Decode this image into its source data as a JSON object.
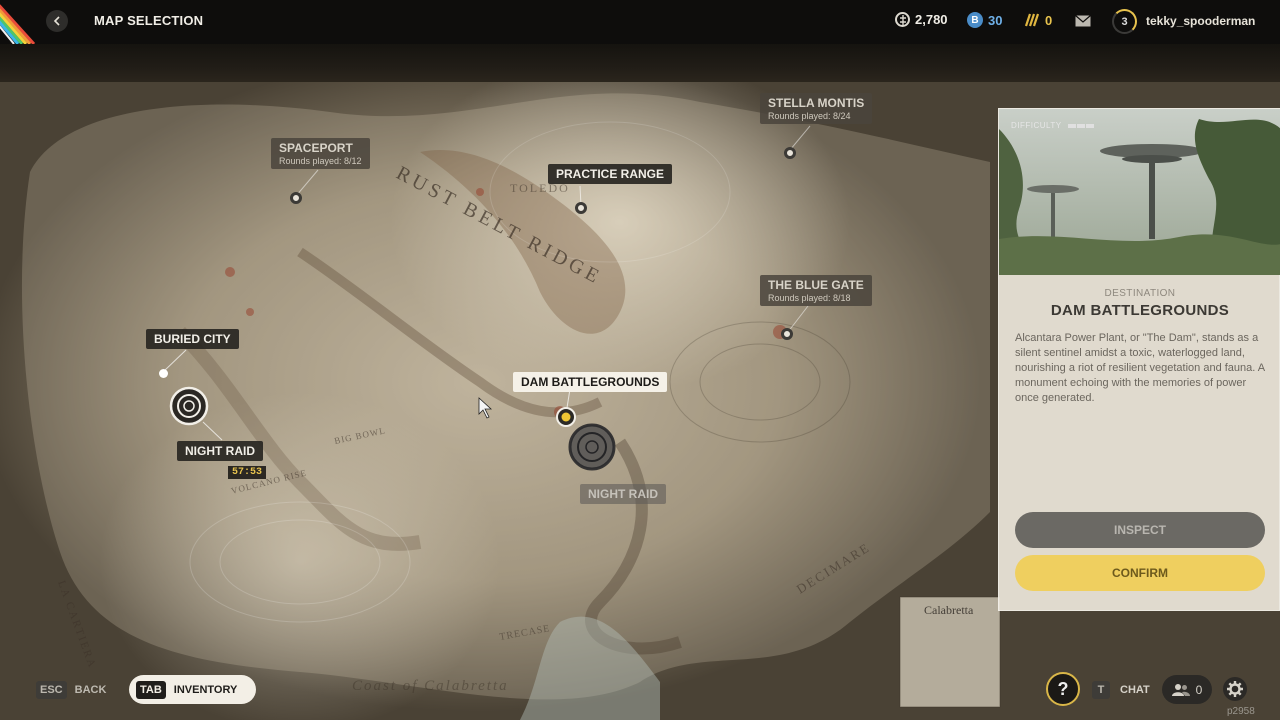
{
  "header": {
    "title": "MAP SELECTION",
    "coins": "2,780",
    "tokens": "30",
    "creds": "0",
    "level": "3",
    "username": "tekky_spooderman"
  },
  "map": {
    "locations": [
      {
        "name": "SPACEPORT",
        "rounds": "Rounds played: 8/12"
      },
      {
        "name": "STELLA MONTIS",
        "rounds": "Rounds played: 8/24"
      },
      {
        "name": "PRACTICE RANGE"
      },
      {
        "name": "THE BLUE GATE",
        "rounds": "Rounds played: 8/18"
      },
      {
        "name": "BURIED CITY"
      },
      {
        "name": "DAM BATTLEGROUNDS"
      }
    ],
    "events": [
      {
        "name": "NIGHT RAID",
        "timer": "57:53"
      },
      {
        "name": "NIGHT RAID"
      }
    ],
    "terrain_labels": {
      "rust_belt_ridge": "RUST BELT RIDGE",
      "toledo": "TOLEDO",
      "big_bowl": "BIG BOWL",
      "volcano_rise": "VOLCANO RISE",
      "la_cartiera": "LA CARTIERA",
      "decimare": "DECIMARE",
      "trecase": "TRECASE",
      "coast": "Coast of Calabretta",
      "calabretta": "Calabretta"
    }
  },
  "panel": {
    "difficulty_label": "DIFFICULTY",
    "destination_label": "DESTINATION",
    "destination_name": "DAM BATTLEGROUNDS",
    "description": "Alcantara Power Plant, or \"The Dam\", stands as a silent sentinel amidst a toxic, waterlogged land, nourishing a riot of resilient vegetation and fauna. A monument echoing with the memories of power once generated.",
    "inspect_label": "INSPECT",
    "confirm_label": "CONFIRM"
  },
  "footer": {
    "esc_key": "ESC",
    "back_label": "BACK",
    "tab_key": "TAB",
    "inventory_label": "INVENTORY",
    "chat_key": "T",
    "chat_label": "CHAT",
    "party_count": "0",
    "session_id": "p2958"
  },
  "colors": {
    "accent_yellow": "#efcf5f",
    "panel_bg": "#ece6da",
    "topbar_bg": "#0e0d0c"
  }
}
